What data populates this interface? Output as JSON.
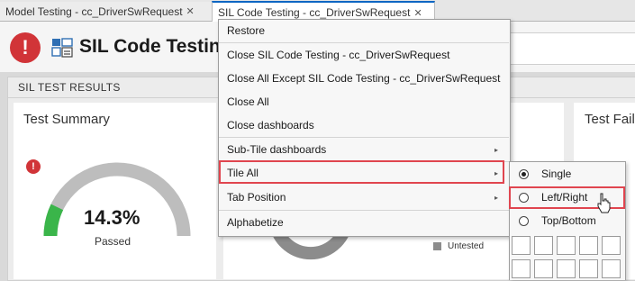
{
  "tabs": [
    {
      "label": "Model Testing - cc_DriverSwRequest",
      "close": "✕"
    },
    {
      "label": "SIL Code Testing - cc_DriverSwRequest",
      "close": "✕"
    }
  ],
  "header": {
    "title": "SIL Code Testing",
    "error_glyph": "!"
  },
  "results": {
    "label": "SIL TEST RESULTS",
    "summary": {
      "title": "Test Summary",
      "error_glyph": "!",
      "value": "14.3%",
      "caption": "Passed",
      "percent": 14.3
    },
    "legend": {
      "label": "Untested",
      "color": "#8c8c8c"
    },
    "fail_title": "Test Fail"
  },
  "context_menu": {
    "items": [
      {
        "label": "Restore"
      },
      {
        "label": "Close SIL Code Testing - cc_DriverSwRequest"
      },
      {
        "label": "Close All Except SIL Code Testing - cc_DriverSwRequest"
      },
      {
        "label": "Close All"
      },
      {
        "label": "Close dashboards"
      },
      {
        "label": "Sub-Tile dashboards",
        "submenu": true
      },
      {
        "label": "Tile All",
        "submenu": true,
        "highlighted": true
      },
      {
        "label": "Tab Position",
        "submenu": true
      },
      {
        "label": "Alphabetize"
      }
    ],
    "arrow_glyph": "▸"
  },
  "tile_submenu": {
    "options": [
      {
        "label": "Single",
        "selected": true
      },
      {
        "label": "Left/Right",
        "selected": false,
        "highlighted": true
      },
      {
        "label": "Top/Bottom",
        "selected": false
      }
    ]
  },
  "colors": {
    "accent": "#0b66c3",
    "error": "#d13438",
    "highlight": "#e0454f",
    "gauge_pass": "#3ab54a",
    "gauge_track": "#bdbdbd"
  }
}
